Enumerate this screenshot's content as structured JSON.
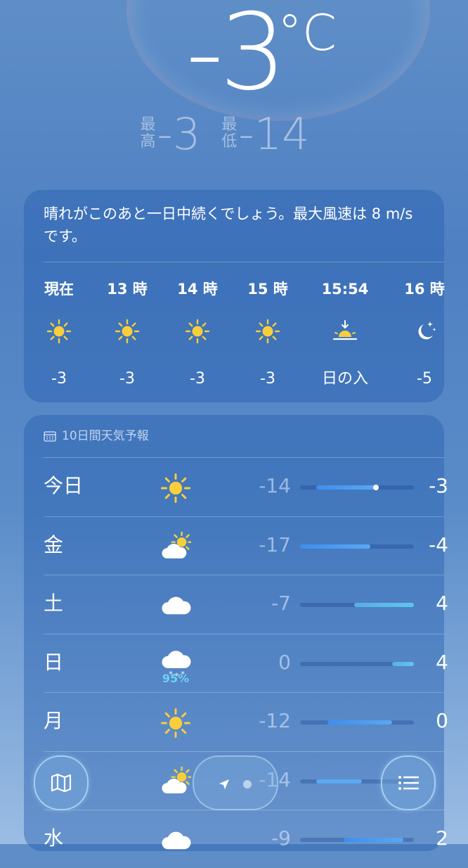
{
  "current": {
    "temp": "-3",
    "unit": "°C"
  },
  "hilo": {
    "high_label": "最\n高",
    "high": "-3",
    "low_label": "最\n低",
    "low": "-14"
  },
  "hourly": {
    "summary": "晴れがこのあと一日中続くでしょう。最大風速は 8 m/sです。",
    "items": [
      {
        "time": "現在",
        "icon": "sun-icon",
        "temp": "-3"
      },
      {
        "time": "13 時",
        "icon": "sun-icon",
        "temp": "-3"
      },
      {
        "time": "14 時",
        "icon": "sun-icon",
        "temp": "-3"
      },
      {
        "time": "15 時",
        "icon": "sun-icon",
        "temp": "-3"
      },
      {
        "time": "15:54",
        "icon": "sunset-icon",
        "temp": "日の入"
      },
      {
        "time": "16 時",
        "icon": "moon-stars-icon",
        "temp": "-5"
      }
    ]
  },
  "daily": {
    "title": "10日間天気予報",
    "range": [
      -17,
      4
    ],
    "rows": [
      {
        "day": "今日",
        "icon": "sun-icon",
        "precip": "",
        "low": "-14",
        "high": "-3",
        "current": -3
      },
      {
        "day": "金",
        "icon": "partly-cloudy-icon",
        "precip": "",
        "low": "-17",
        "high": "-4"
      },
      {
        "day": "土",
        "icon": "cloud-icon",
        "precip": "",
        "low": "-7",
        "high": "4"
      },
      {
        "day": "日",
        "icon": "cloud-snow-icon",
        "precip": "95%",
        "low": "0",
        "high": "4"
      },
      {
        "day": "月",
        "icon": "sun-icon",
        "precip": "",
        "low": "-12",
        "high": "0"
      },
      {
        "day": "",
        "icon": "partly-cloudy-icon",
        "precip": "",
        "low": "-14",
        "high": ""
      },
      {
        "day": "水",
        "icon": "cloud-icon",
        "precip": "",
        "low": "-9",
        "high": "2"
      }
    ]
  },
  "colors": {
    "sun": "#f8cf3a",
    "cold": "#3d8ef0",
    "mild": "#5ec6ea"
  },
  "toolbar": {
    "map_icon": "map-icon",
    "location_icon": "location-arrow-icon",
    "list_icon": "list-icon"
  }
}
